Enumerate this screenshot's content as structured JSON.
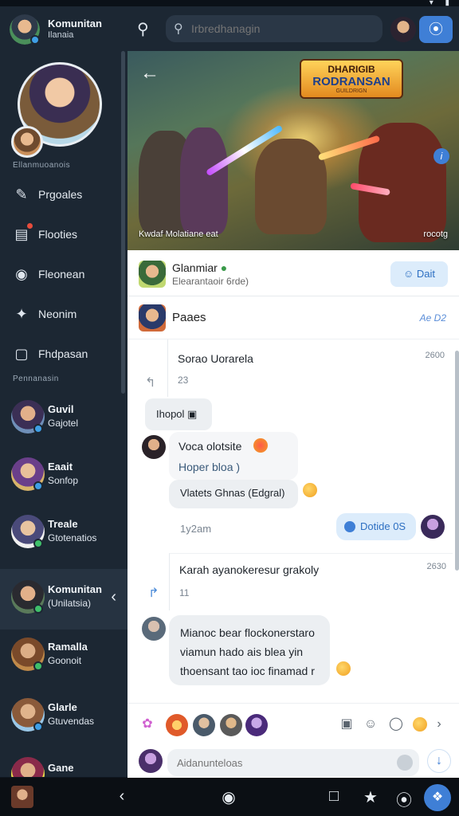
{
  "sidebar": {
    "app_title": "Komunitan",
    "app_subtitle": "Ilanaia",
    "profile_caption": "Ellanmuoanois",
    "nav": [
      {
        "label": "Prgoales",
        "icon": "megaphone-icon"
      },
      {
        "label": "Flooties",
        "icon": "film-icon"
      },
      {
        "label": "Fleonean",
        "icon": "controller-icon"
      },
      {
        "label": "Neonim",
        "icon": "puzzle-icon"
      },
      {
        "label": "Fhdpasan",
        "icon": "chat-square-icon"
      }
    ],
    "section_label": "Pennanasin",
    "chats": [
      {
        "name": "Guvil",
        "sub": "Gajotel"
      },
      {
        "name": "Eaait",
        "sub": "Sonfop"
      },
      {
        "name": "Treale",
        "sub": "Gtotenatios"
      },
      {
        "name": "Komunitan",
        "sub": "(Unilatsia)"
      },
      {
        "name": "Ramalla",
        "sub": "Goonoit"
      },
      {
        "name": "Glarle",
        "sub": "Gtuvendas"
      },
      {
        "name": "Gane",
        "sub": ""
      }
    ]
  },
  "topbar": {
    "search_placeholder": "Irbredhanagin"
  },
  "banner": {
    "logo_line1": "DHARIGIB",
    "logo_line2": "RODRANSAN",
    "logo_line3": "GUILDRIGN",
    "caption_left": "Kwdaf Molatiane eat",
    "caption_right": "rocotg"
  },
  "main": {
    "header_title": "Glanmiar",
    "header_sub": "Elearantaoir 6rde)",
    "edit_label": "Dait",
    "pages_label": "Paaes",
    "pages_right": "Ae D2",
    "messages": [
      {
        "text": "Sorao Uorarela",
        "time": "2600",
        "count": "23"
      },
      {
        "text": "Ihopol"
      },
      {
        "text1": "Voca olotsite",
        "text2": "Hoper bloa )",
        "text3": "Vlatets Ghnas (Edgral)"
      },
      {
        "meta": "1y2am",
        "chip": "Dotide 0S"
      },
      {
        "text": "Karah ayanokeresur grakoly",
        "time": "2630",
        "count": "11"
      },
      {
        "line1": "Mianoc bear flockonerstaro",
        "line2": "viamun hado ais blea yin",
        "line3": "thoensant tao ioc finamad r"
      }
    ]
  },
  "composer": {
    "placeholder": "Aidanunteloas"
  }
}
